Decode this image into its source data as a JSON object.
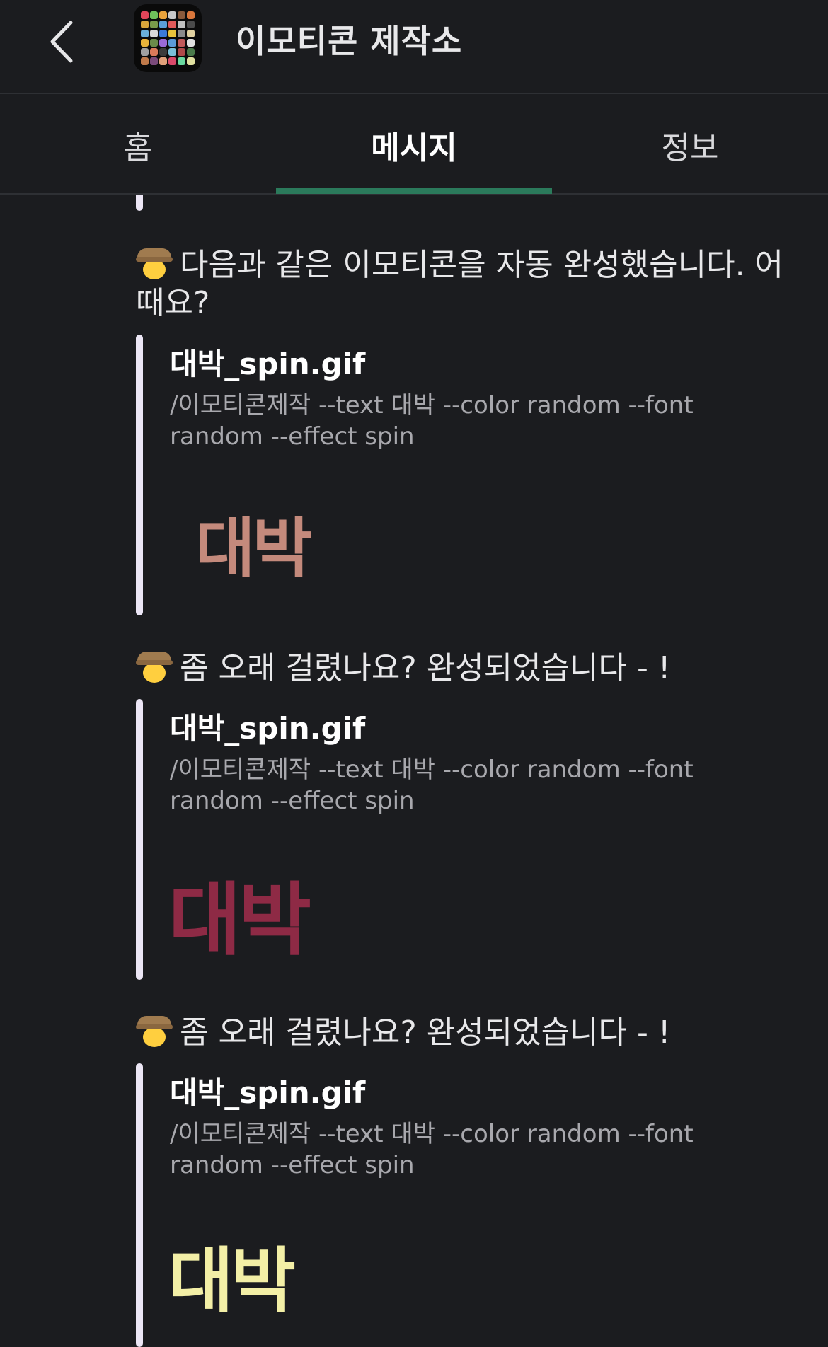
{
  "header": {
    "title": "이모티콘 제작소",
    "back_icon": "chevron-left-icon",
    "app_icon": "emoji-grid-icon"
  },
  "tabs": [
    {
      "label": "홈",
      "active": false
    },
    {
      "label": "메시지",
      "active": true
    },
    {
      "label": "정보",
      "active": false
    }
  ],
  "colors": {
    "background": "#1b1c1f",
    "accent": "#2b7a5b",
    "attachment_bar": "#ece6f5"
  },
  "messages": [
    {
      "emoji": "cowboy-face-icon",
      "text": "다음과 같은 이모티콘을 자동 완성했습니다. 어때요?",
      "attachment": {
        "file_name": "대박_spin.gif",
        "command": "/이모티콘제작 --text 대박 --color random --font random --effect spin",
        "gif_text": "대박",
        "gif_color": "#c48a7c"
      }
    },
    {
      "emoji": "cowboy-face-icon",
      "text": "좀 오래 걸렸나요? 완성되었습니다 - !",
      "attachment": {
        "file_name": "대박_spin.gif",
        "command": "/이모티콘제작 --text 대박 --color random --font random --effect spin",
        "gif_text": "대박",
        "gif_color": "#8e2a45"
      }
    },
    {
      "emoji": "cowboy-face-icon",
      "text": "좀 오래 걸렸나요? 완성되었습니다 - !",
      "attachment": {
        "file_name": "대박_spin.gif",
        "command": "/이모티콘제작 --text 대박 --color random --font random --effect spin",
        "gif_text": "대박",
        "gif_color": "#f3efa6"
      }
    }
  ]
}
